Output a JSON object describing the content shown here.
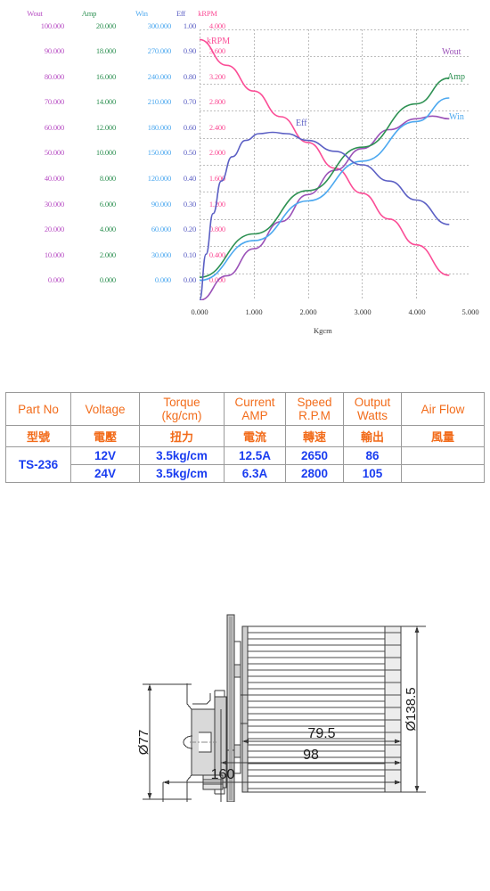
{
  "chart_data": {
    "type": "line",
    "title": "",
    "xlabel": "Kgcm",
    "xlim": [
      0,
      5
    ],
    "xticks": [
      "0.000",
      "1.000",
      "2.000",
      "3.000",
      "4.000",
      "5.000"
    ],
    "grid": true,
    "legend_position": "inline-right",
    "axes": [
      {
        "name": "Wout",
        "color": "#b84fc4",
        "ticks": [
          "100.000",
          "90.000",
          "80.000",
          "70.000",
          "60.000",
          "50.000",
          "40.000",
          "30.000",
          "20.000",
          "10.000",
          "0.000"
        ],
        "range": [
          0,
          100
        ]
      },
      {
        "name": "Amp",
        "color": "#2e9153",
        "ticks": [
          "20.000",
          "18.000",
          "16.000",
          "14.000",
          "12.000",
          "10.000",
          "8.000",
          "6.000",
          "4.000",
          "2.000",
          "0.000"
        ],
        "range": [
          0,
          20
        ]
      },
      {
        "name": "Win",
        "color": "#4ca8ef",
        "ticks": [
          "300.000",
          "270.000",
          "240.000",
          "210.000",
          "180.000",
          "150.000",
          "120.000",
          "90.000",
          "60.000",
          "30.000",
          "0.000"
        ],
        "range": [
          0,
          300
        ]
      },
      {
        "name": "Eff",
        "color": "#5b5fc4",
        "ticks": [
          "1.00",
          "0.90",
          "0.80",
          "0.70",
          "0.60",
          "0.50",
          "0.40",
          "0.30",
          "0.20",
          "0.10",
          "0.00"
        ],
        "range": [
          0,
          1
        ]
      },
      {
        "name": "kRPM",
        "color": "#fb4d96",
        "ticks": [
          "4.000",
          "3.600",
          "3.200",
          "2.800",
          "2.400",
          "2.000",
          "1.600",
          "1.200",
          "0.800",
          "0.400",
          "0.000"
        ],
        "range": [
          0,
          4
        ]
      }
    ],
    "series": [
      {
        "name": "kRPM",
        "color": "#fb4d96",
        "label": "kRPM",
        "axis": "kRPM",
        "points": [
          [
            0,
            3.85
          ],
          [
            0.5,
            3.47
          ],
          [
            1.0,
            3.09
          ],
          [
            1.5,
            2.71
          ],
          [
            2.0,
            2.33
          ],
          [
            2.5,
            1.95
          ],
          [
            3.0,
            1.58
          ],
          [
            3.5,
            1.2
          ],
          [
            4.0,
            0.82
          ],
          [
            4.6,
            0.37
          ]
        ]
      },
      {
        "name": "Wout",
        "color": "#9b52b8",
        "label": "Wout",
        "axis": "Wout",
        "points": [
          [
            0,
            0
          ],
          [
            0.5,
            9
          ],
          [
            1.0,
            19
          ],
          [
            1.5,
            29
          ],
          [
            2.0,
            39
          ],
          [
            2.5,
            48
          ],
          [
            3.0,
            56
          ],
          [
            3.5,
            63
          ],
          [
            4.0,
            67
          ],
          [
            4.3,
            68
          ],
          [
            4.6,
            67
          ]
        ]
      },
      {
        "name": "Amp",
        "color": "#2e9153",
        "label": "Amp",
        "axis": "Amp",
        "points": [
          [
            0,
            1.7
          ],
          [
            1.0,
            4.9
          ],
          [
            2.0,
            8.1
          ],
          [
            3.0,
            11.3
          ],
          [
            4.0,
            14.5
          ],
          [
            4.6,
            16.4
          ]
        ]
      },
      {
        "name": "Win",
        "color": "#4ca8ef",
        "label": "Win",
        "axis": "Win",
        "points": [
          [
            0,
            22
          ],
          [
            1.0,
            66
          ],
          [
            2.0,
            110
          ],
          [
            3.0,
            154
          ],
          [
            4.0,
            198
          ],
          [
            4.6,
            224
          ]
        ]
      },
      {
        "name": "Eff",
        "color": "#5b5fc4",
        "label": "Eff",
        "axis": "Eff",
        "points": [
          [
            0,
            0.0
          ],
          [
            0.12,
            0.17
          ],
          [
            0.25,
            0.32
          ],
          [
            0.4,
            0.44
          ],
          [
            0.6,
            0.53
          ],
          [
            0.85,
            0.59
          ],
          [
            1.1,
            0.615
          ],
          [
            1.35,
            0.62
          ],
          [
            1.6,
            0.615
          ],
          [
            2.0,
            0.59
          ],
          [
            2.5,
            0.55
          ],
          [
            3.0,
            0.5
          ],
          [
            3.5,
            0.44
          ],
          [
            4.0,
            0.37
          ],
          [
            4.6,
            0.28
          ]
        ]
      }
    ]
  },
  "spec_table": {
    "headers_en": [
      "Part No",
      "Voltage",
      "Torque\n(kg/cm)",
      "Current\nAMP",
      "Speed\nR.P.M",
      "Output\nWatts",
      "Air  Flow"
    ],
    "headers_en_line1": [
      "Part No",
      "Voltage",
      "Torque",
      "Current",
      "Speed",
      "Output",
      "Air  Flow"
    ],
    "headers_en_line2": [
      "",
      "",
      "(kg/cm)",
      "AMP",
      "R.P.M",
      "Watts",
      ""
    ],
    "headers_cn": [
      "型號",
      "電壓",
      "扭力",
      "電流",
      "轉速",
      "輸出",
      "風量"
    ],
    "part_no": "TS-236",
    "rows": [
      {
        "voltage": "12V",
        "torque": "3.5kg/cm",
        "current": "12.5A",
        "speed": "2650",
        "output": "86",
        "airflow": ""
      },
      {
        "voltage": "24V",
        "torque": "3.5kg/cm",
        "current": "6.3A",
        "speed": "2800",
        "output": "105",
        "airflow": ""
      }
    ],
    "header_color": "#f26c1b",
    "value_color": "#1a3df0"
  },
  "drawing": {
    "dimensions": {
      "motor_diameter": "Ø77",
      "wheel_diameter": "Ø138.5",
      "wheel_width": "79.5",
      "mid_length": "98",
      "total_length": "160"
    }
  }
}
